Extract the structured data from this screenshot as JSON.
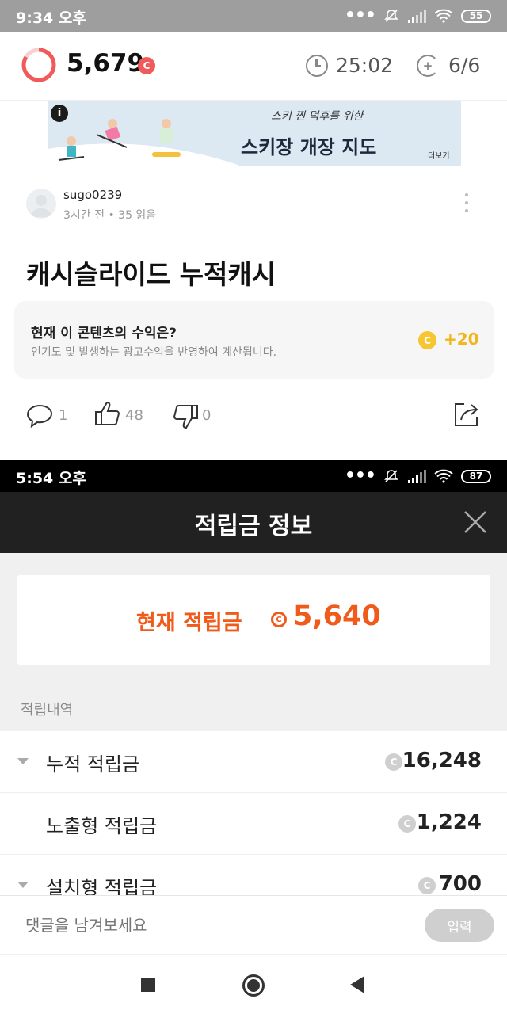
{
  "status_bar_top": {
    "time": "9:34 오후",
    "battery": "55"
  },
  "top_bar": {
    "points": "5,679",
    "coin_symbol": "C",
    "timer": "25:02",
    "count": "6/6"
  },
  "banner": {
    "badge": "i",
    "subtitle": "스키 찐 덕후를 위한",
    "title": "스키장 개장 지도",
    "more": "더보기"
  },
  "post": {
    "author": "sugo0239",
    "meta": "3시간 전 • 35 읽음",
    "title": "캐시슬라이드 누적캐시"
  },
  "revenue": {
    "question": "현재 이 콘텐츠의 수익은?",
    "description": "인기도 및 발생하는 광고수익을 반영하여 계산됩니다.",
    "coin_symbol": "C",
    "amount": "+20"
  },
  "actions": {
    "comments": "1",
    "likes": "48",
    "dislikes": "0"
  },
  "status_bar_bottom": {
    "time": "5:54 오후",
    "battery": "87"
  },
  "savings_screen": {
    "title": "적립금 정보",
    "balance_label": "현재 적립금",
    "coin_symbol": "C",
    "balance": "5,640",
    "history_label": "적립내역",
    "rows": [
      {
        "label": "누적 적립금",
        "value": "16,248",
        "expanded": true
      },
      {
        "label": "노출형 적립금",
        "value": "1,224",
        "expanded": false
      },
      {
        "label": "설치형 적립금",
        "value": "700",
        "expanded": true
      }
    ]
  },
  "comment_bar": {
    "placeholder": "댓글을 남겨보세요",
    "submit_label": "입력"
  },
  "colors": {
    "accent_red": "#f05a5a",
    "accent_orange": "#f05a1a",
    "coin_yellow": "#f7c530"
  }
}
